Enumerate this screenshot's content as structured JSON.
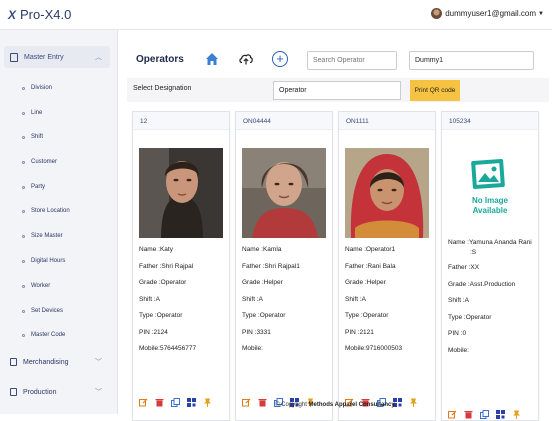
{
  "app": {
    "title": "Pro-X4.0",
    "user_email": "dummyuser1@gmail.com"
  },
  "sidebar": {
    "section": "Master Entry",
    "items": [
      {
        "label": "Division"
      },
      {
        "label": "Line"
      },
      {
        "label": "Shift"
      },
      {
        "label": "Customer"
      },
      {
        "label": "Party"
      },
      {
        "label": "Store Location"
      },
      {
        "label": "Size Master"
      },
      {
        "label": "Digital Hours"
      },
      {
        "label": "Worker"
      },
      {
        "label": "Set Devices"
      },
      {
        "label": "Master Code"
      }
    ],
    "groups": [
      {
        "label": "Merchandising"
      },
      {
        "label": "Production"
      }
    ]
  },
  "header": {
    "title": "Operators",
    "search_placeholder": "Search Operator",
    "tenant_value": "Dummy1"
  },
  "designation": {
    "label": "Select Designation",
    "value": "Operator",
    "print_label": "Print QR code"
  },
  "cards": [
    {
      "id": "12",
      "fields": [
        "Name  :Katy",
        "Father :Shri Rajpal",
        "Grade  :Operator",
        "Shift   :A",
        "Type   :Operator",
        "PIN     :2124",
        "Mobile:5764456777"
      ]
    },
    {
      "id": "ON04444",
      "fields": [
        "Name  :Kamla",
        "Father :Shri Rajpal1",
        "Grade  :Helper",
        "Shift   :A",
        "Type   :Operator",
        "PIN     :3331",
        "Mobile:"
      ]
    },
    {
      "id": "ON1111",
      "fields": [
        "Name  :Operator1",
        "Father :Rani Bala",
        "Grade  :Helper",
        "Shift   :A",
        "Type   :Operator",
        "PIN     :2121",
        "Mobile:9716000503"
      ]
    },
    {
      "id": "105234",
      "no_image_text": [
        "No Image",
        "Available"
      ],
      "name_line1": "Name  :Yamuna Ananda Rani",
      "name_line2": ":S",
      "fields": [
        "Father :XX",
        "Grade  :Asst.Production",
        "Shift   :A",
        "Type   :Operator",
        "PIN     :0",
        "Mobile:"
      ]
    }
  ],
  "footer": {
    "prefix": "© Copyright",
    "company": "Methods Apparel Consultancy."
  },
  "colors": {
    "accent": "#2b5fb8",
    "button": "#f5c242",
    "edit": "#e07b1a",
    "delete": "#d63a3a",
    "copy": "#3b6fd0",
    "qr": "#2b3fa8",
    "pin": "#e0a21a"
  }
}
